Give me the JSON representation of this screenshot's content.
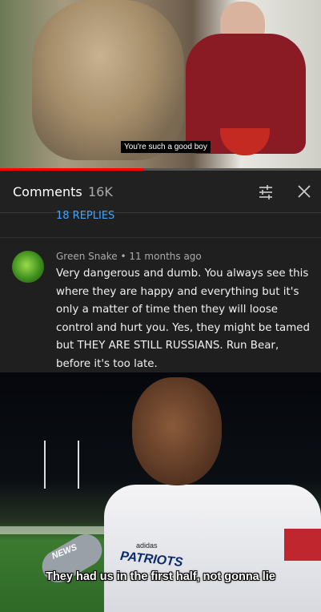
{
  "video": {
    "caption": "You're such a good boy",
    "progress_percent": 45
  },
  "comments_panel": {
    "title": "Comments",
    "count": "16K",
    "icons": [
      "filter-icon",
      "close-icon"
    ],
    "replies_link": "18 REPLIES"
  },
  "comment": {
    "author": "Green Snake",
    "time": "11 months ago",
    "meta": "Green Snake • 11 months ago",
    "body": "Very dangerous and dumb. You always see this where they are happy and everything but it's only a matter of time then they will loose control and hurt you. Yes, they might be tamed but THEY ARE STILL RUSSIANS. Run Bear, before it's too late."
  },
  "meme": {
    "caption": "They had us in the first half, not gonna lie",
    "brand": "adidas",
    "jersey_text": "PATRIOTS",
    "mic_logo": "NEWS"
  },
  "colors": {
    "background": "#1f1f1f",
    "link": "#3ea6ff",
    "progress": "#ff0000"
  }
}
